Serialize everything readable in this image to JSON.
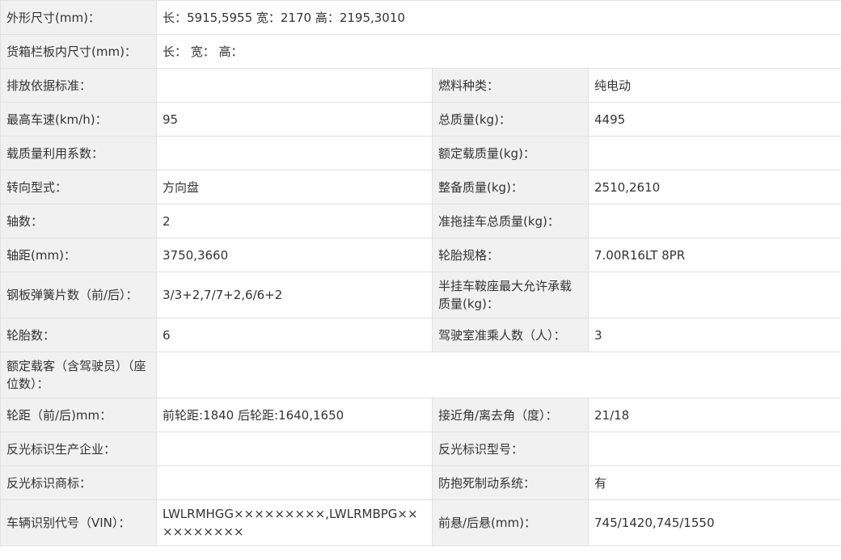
{
  "rows": [
    {
      "full": true,
      "l1": "外形尺寸(mm)：",
      "v1": "长：5915,5955 宽：2170 高：2195,3010"
    },
    {
      "full": true,
      "l1": "货箱栏板内尺寸(mm)：",
      "v1": "长： 宽： 高："
    },
    {
      "full": false,
      "l1": "排放依据标准：",
      "v1": "",
      "l2": "燃料种类：",
      "v2": "纯电动"
    },
    {
      "full": false,
      "l1": "最高车速(km/h)：",
      "v1": "95",
      "l2": "总质量(kg)：",
      "v2": "4495"
    },
    {
      "full": false,
      "l1": "载质量利用系数：",
      "v1": "",
      "l2": "额定载质量(kg)：",
      "v2": ""
    },
    {
      "full": false,
      "l1": "转向型式：",
      "v1": "方向盘",
      "l2": "整备质量(kg)：",
      "v2": "2510,2610"
    },
    {
      "full": false,
      "l1": "轴数：",
      "v1": "2",
      "l2": "准拖挂车总质量(kg)：",
      "v2": ""
    },
    {
      "full": false,
      "l1": "轴距(mm)：",
      "v1": "3750,3660",
      "l2": "轮胎规格：",
      "v2": "7.00R16LT 8PR"
    },
    {
      "full": false,
      "tall": true,
      "l1": "钢板弹簧片数（前/后）：",
      "v1": "3/3+2,7/7+2,6/6+2",
      "l2": "半挂车鞍座最大允许承载质量(kg)：",
      "v2": ""
    },
    {
      "full": false,
      "l1": "轮胎数：",
      "v1": "6",
      "l2": "驾驶室准乘人数（人）：",
      "v2": "3"
    },
    {
      "full": true,
      "tall": true,
      "l1": "额定载客（含驾驶员）（座位数）：",
      "v1": ""
    },
    {
      "full": false,
      "l1": "轮距（前/后)mm：",
      "v1": "前轮距:1840 后轮距:1640,1650",
      "l2": "接近角/离去角（度）：",
      "v2": "21/18"
    },
    {
      "full": false,
      "l1": "反光标识生产企业：",
      "v1": "",
      "l2": "反光标识型号：",
      "v2": ""
    },
    {
      "full": false,
      "l1": "反光标识商标：",
      "v1": "",
      "l2": "防抱死制动系统：",
      "v2": "有"
    },
    {
      "full": false,
      "tall": true,
      "l1": "车辆识别代号（VIN）：",
      "v1": "LWLRMHGG×××××××××,LWLRMBPG××××××××××",
      "l2": "前悬/后悬(mm)：",
      "v2": "745/1420,745/1550"
    }
  ]
}
